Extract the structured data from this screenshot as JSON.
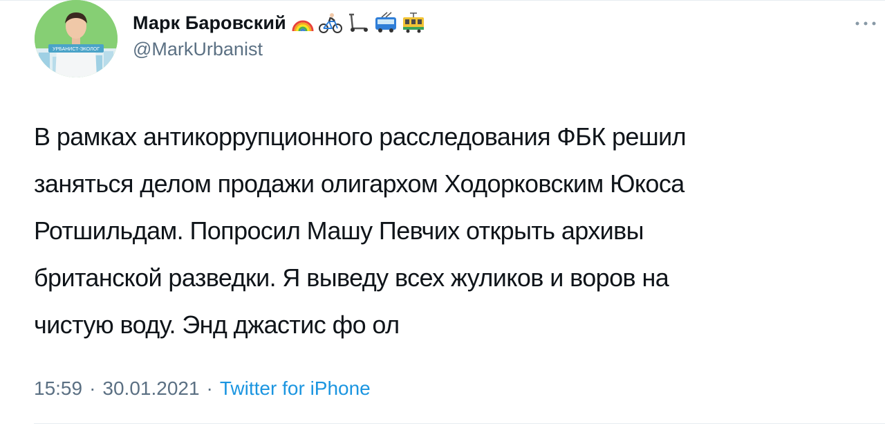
{
  "author": {
    "display_name": "Марк Баровский",
    "handle": "@MarkUrbanist",
    "avatar_badge_text": "УРБАНИСТ-ЭКОЛОГ",
    "name_emojis": [
      "rainbow-icon",
      "cyclist-icon",
      "kick-scooter-icon",
      "trolleybus-icon",
      "tram-icon"
    ]
  },
  "tweet": {
    "text": "В рамках антикоррупционного расследования ФБК решил\nзаняться делом продажи олигархом Ходорковским Юкоса\nРотшильдам. Попросил Машу Певчих открыть архивы\nбританской разведки. Я выведу всех жуликов и воров на\nчистую воду. Энд джастис фо ол"
  },
  "meta": {
    "time": "15:59",
    "separator": "·",
    "date": "30.01.2021",
    "source": "Twitter for iPhone"
  },
  "colors": {
    "text": "#0f1419",
    "secondary": "#5b7083",
    "link": "#1b95e0",
    "divider": "#e6ecf0"
  }
}
